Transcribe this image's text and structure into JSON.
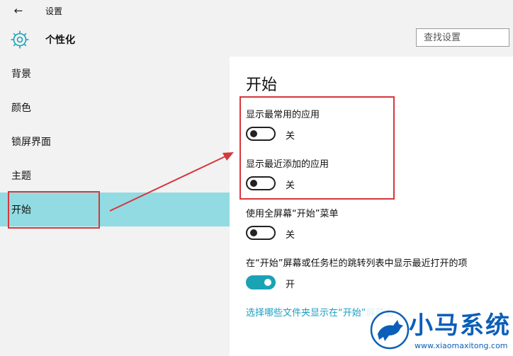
{
  "window": {
    "title": "设置",
    "back_icon": "back-arrow-icon"
  },
  "header": {
    "icon": "gear-icon",
    "title": "个性化",
    "search_placeholder": "查找设置"
  },
  "sidebar": {
    "items": [
      {
        "label": "背景"
      },
      {
        "label": "颜色"
      },
      {
        "label": "锁屏界面"
      },
      {
        "label": "主题"
      },
      {
        "label": "开始",
        "active": true
      }
    ]
  },
  "main": {
    "section_title": "开始",
    "settings": [
      {
        "label": "显示最常用的应用",
        "state": "关",
        "on": false
      },
      {
        "label": "显示最近添加的应用",
        "state": "关",
        "on": false
      },
      {
        "label": "使用全屏幕“开始”菜单",
        "state": "关",
        "on": false
      },
      {
        "label": "在“开始”屏幕或任务栏的跳转列表中显示最近打开的项",
        "state": "开",
        "on": true
      }
    ],
    "link_text": "选择哪些文件夹显示在“开始”屏幕上"
  },
  "colors": {
    "accent": "#1aa3b5",
    "nav_active": "#92dbe2",
    "annotation_red": "#d6373c",
    "link": "#1a9ec2"
  },
  "watermark": {
    "brand": "小马系统",
    "url": "www.xiaomaxitong.com"
  }
}
